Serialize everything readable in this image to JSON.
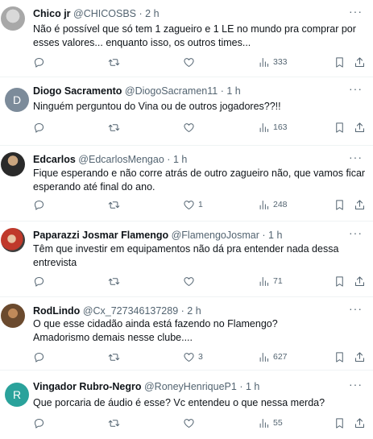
{
  "tweets": [
    {
      "name": "Chico jr",
      "handle": "@CHICOSBS",
      "time": "2 h",
      "text": "Não é possível que só tem 1 zagueiro e 1 LE no mundo pra comprar por\nesses valores... enquanto isso, os outros times...",
      "replies": "",
      "retweets": "",
      "likes": "",
      "views": "333"
    },
    {
      "name": "Diogo Sacramento",
      "handle": "@DiogoSacramen11",
      "time": "1 h",
      "avatar_letter": "D",
      "text": "Ninguém perguntou do Vina ou de outros jogadores??!!",
      "replies": "",
      "retweets": "",
      "likes": "",
      "views": "163"
    },
    {
      "name": "Edcarlos",
      "handle": "@EdcarlosMengao",
      "time": "1 h",
      "text": "Fique esperando e não corre atrás de outro zagueiro não, que vamos ficar\nesperando até final do ano.",
      "replies": "",
      "retweets": "",
      "likes": "1",
      "views": "248"
    },
    {
      "name": "Paparazzi Josmar Flamengo",
      "handle": "@FlamengoJosmar",
      "time": "1 h",
      "text": "Têm que investir em equipamentos não dá pra entender nada dessa\nentrevista",
      "replies": "",
      "retweets": "",
      "likes": "",
      "views": "71"
    },
    {
      "name": "RodLindo",
      "handle": "@Cx_727346137289",
      "time": "2 h",
      "text": "O que esse cidadão ainda está fazendo no Flamengo?\nAmadorismo demais nesse clube....",
      "replies": "",
      "retweets": "",
      "likes": "3",
      "views": "627"
    },
    {
      "name": "Vingador Rubro-Negro",
      "handle": "@RoneyHenriqueP1",
      "time": "1 h",
      "avatar_letter": "R",
      "text": "Que porcaria de áudio é esse? Vc entendeu o que nessa merda?",
      "replies": "",
      "retweets": "",
      "likes": "",
      "views": "55"
    }
  ],
  "separator": "·",
  "more_glyph": "···",
  "icons": [
    "reply-icon",
    "retweet-icon",
    "like-icon",
    "views-icon",
    "bookmark-icon",
    "share-icon"
  ],
  "colors": {
    "text": "#0f1419",
    "secondary": "#536471",
    "divider": "#eff3f4"
  }
}
